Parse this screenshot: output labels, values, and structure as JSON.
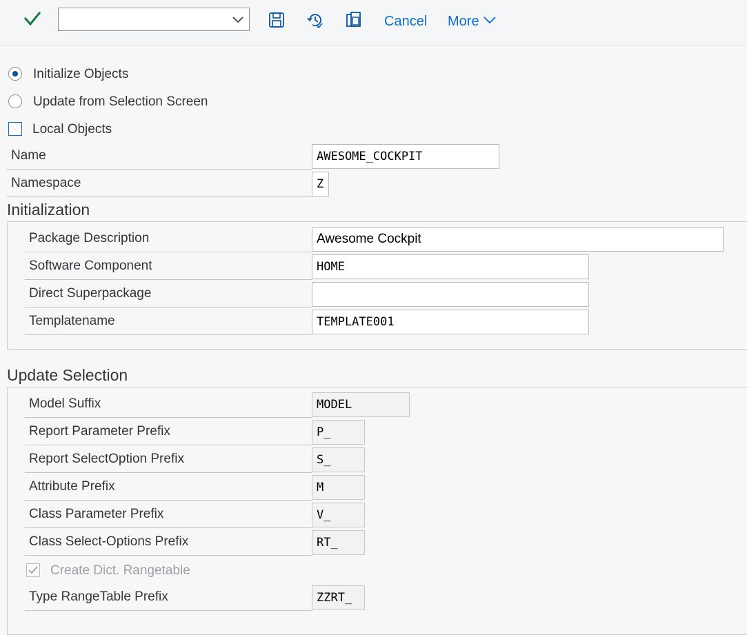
{
  "toolbar": {
    "combo_value": "",
    "cancel_label": "Cancel",
    "more_label": "More"
  },
  "options": {
    "initialize_objects": "Initialize Objects",
    "update_from_selection": "Update from Selection Screen",
    "local_objects": "Local Objects",
    "selected": "initialize_objects",
    "local_objects_checked": false
  },
  "top_fields": {
    "name_label": "Name",
    "name_value": "AWESOME_COCKPIT",
    "namespace_label": "Namespace",
    "namespace_value": "Z"
  },
  "initialization": {
    "title": "Initialization",
    "package_description_label": "Package Description",
    "package_description_value": "Awesome Cockpit",
    "software_component_label": "Software Component",
    "software_component_value": "HOME",
    "direct_superpackage_label": "Direct Superpackage",
    "direct_superpackage_value": "",
    "templatename_label": "Templatename",
    "templatename_value": "TEMPLATE001"
  },
  "update_selection": {
    "title": "Update Selection",
    "model_suffix_label": "Model Suffix",
    "model_suffix_value": "MODEL",
    "report_parameter_prefix_label": "Report Parameter Prefix",
    "report_parameter_prefix_value": "P_",
    "report_selectoption_prefix_label": "Report SelectOption Prefix",
    "report_selectoption_prefix_value": "S_",
    "attribute_prefix_label": "Attribute Prefix",
    "attribute_prefix_value": "M",
    "class_parameter_prefix_label": "Class Parameter Prefix",
    "class_parameter_prefix_value": "V_",
    "class_selectoptions_prefix_label": "Class Select-Options Prefix",
    "class_selectoptions_prefix_value": "RT_",
    "create_dict_rangetable_label": "Create Dict. Rangetable",
    "create_dict_rangetable_checked": true,
    "type_rangetable_prefix_label": "Type RangeTable Prefix",
    "type_rangetable_prefix_value": "ZZRT_"
  },
  "colors": {
    "accent": "#0a6ed1",
    "check_green": "#107e3e",
    "background": "#f7f7f7"
  }
}
